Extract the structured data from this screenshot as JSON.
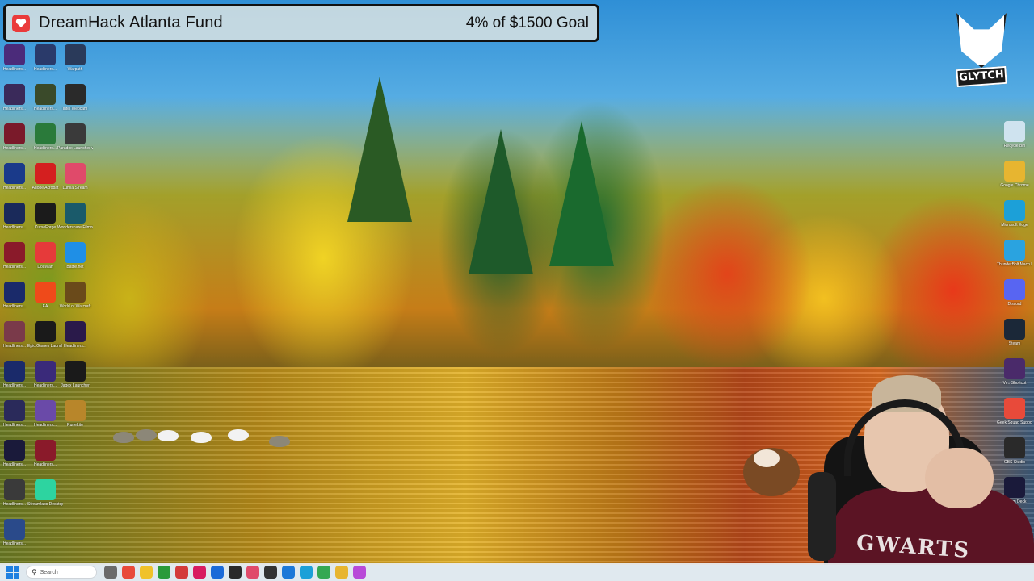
{
  "donation": {
    "title": "DreamHack Atlanta Fund",
    "goal_text": "4% of $1500 Goal",
    "progress_fraction": 0.04
  },
  "webcam": {
    "shirt_text": "GWARTS"
  },
  "taskbar": {
    "search_placeholder": "Search"
  },
  "desktop_icons_left": [
    {
      "label": "Headliners...",
      "color": "#4b2b7a"
    },
    {
      "label": "Headliners...",
      "color": "#3a2a5a"
    },
    {
      "label": "Headliners...",
      "color": "#7a1a2a"
    },
    {
      "label": "Headliners...",
      "color": "#1a3a8a"
    },
    {
      "label": "Headliners...",
      "color": "#1a2a5a"
    },
    {
      "label": "Headliners...",
      "color": "#8a1a2a"
    },
    {
      "label": "Headliners...",
      "color": "#1a2a6a"
    },
    {
      "label": "Headliners...",
      "color": "#7a3a4a"
    },
    {
      "label": "Headliners...",
      "color": "#1a2a6a"
    },
    {
      "label": "Headliners...",
      "color": "#2a2a5a"
    },
    {
      "label": "Headliners...",
      "color": "#1a1a3a"
    },
    {
      "label": "Headliners...",
      "color": "#3a3a3a"
    },
    {
      "label": "Headliners...",
      "color": "#2a4a8a"
    }
  ],
  "desktop_icons_mid": [
    {
      "label": "Headliners...",
      "color": "#2a3a6a"
    },
    {
      "label": "Headliners...",
      "color": "#3a4a2a"
    },
    {
      "label": "Headliners...",
      "color": "#2a7a3a"
    },
    {
      "label": "Adobe Acrobat",
      "color": "#d41f1f"
    },
    {
      "label": "CurseForge",
      "color": "#1b1b1b"
    },
    {
      "label": "DouWan",
      "color": "#e63a3a"
    },
    {
      "label": "EA",
      "color": "#ef4a1a"
    },
    {
      "label": "Epic Games Launcher",
      "color": "#1a1a1a"
    },
    {
      "label": "Headliners...",
      "color": "#3a2a7a"
    },
    {
      "label": "Headliners...",
      "color": "#6a4aa8"
    },
    {
      "label": "Headliners...",
      "color": "#8a1a2a"
    },
    {
      "label": "Streamlabs Desktop",
      "color": "#2dd4a0"
    }
  ],
  "desktop_icons_right_col": [
    {
      "label": "Warpath",
      "color": "#2a3a5a"
    },
    {
      "label": "Intel Webcam",
      "color": "#2a2a2a"
    },
    {
      "label": "Paradox Launcher v2",
      "color": "#3a3a3a"
    },
    {
      "label": "Lumia Stream",
      "color": "#e04a6a"
    },
    {
      "label": "Wondershare Filmora 14",
      "color": "#1a5a6a"
    },
    {
      "label": "Battle.net",
      "color": "#1f8fe6"
    },
    {
      "label": "World of Warcraft",
      "color": "#6a4a1a"
    },
    {
      "label": "Headliners...",
      "color": "#2a1a4a"
    },
    {
      "label": "Jagex Launcher",
      "color": "#1a1a1a"
    },
    {
      "label": "RuneLite",
      "color": "#b8862a"
    }
  ],
  "desktop_icons_far_right": [
    {
      "label": "Recycle Bin",
      "color": "#cfe3ef"
    },
    {
      "label": "Google Chrome",
      "color": "#e7b530"
    },
    {
      "label": "Microsoft Edge",
      "color": "#1ca0d8"
    },
    {
      "label": "ThunderBolt Mach Lite",
      "color": "#2aa3e0"
    },
    {
      "label": "Discord",
      "color": "#5865f2"
    },
    {
      "label": "Steam",
      "color": "#1b2838"
    },
    {
      "label": "Vr... Shortcut",
      "color": "#4a2a6a"
    },
    {
      "label": "Geek Squad Support.exe",
      "color": "#e84a3a"
    },
    {
      "label": "OBS Studio",
      "color": "#2a2a2a"
    },
    {
      "label": "Stream Deck",
      "color": "#1a1a3a"
    }
  ],
  "taskbar_apps": [
    "#6a6a6a",
    "#e84a3a",
    "#f0c22a",
    "#2a9a3a",
    "#d33a3a",
    "#d81b60",
    "#1a6ad8",
    "#2a2a2a",
    "#e04a6a",
    "#333333",
    "#1b78d8",
    "#1ca0d8",
    "#34a853",
    "#e7b530",
    "#b84ad8"
  ]
}
